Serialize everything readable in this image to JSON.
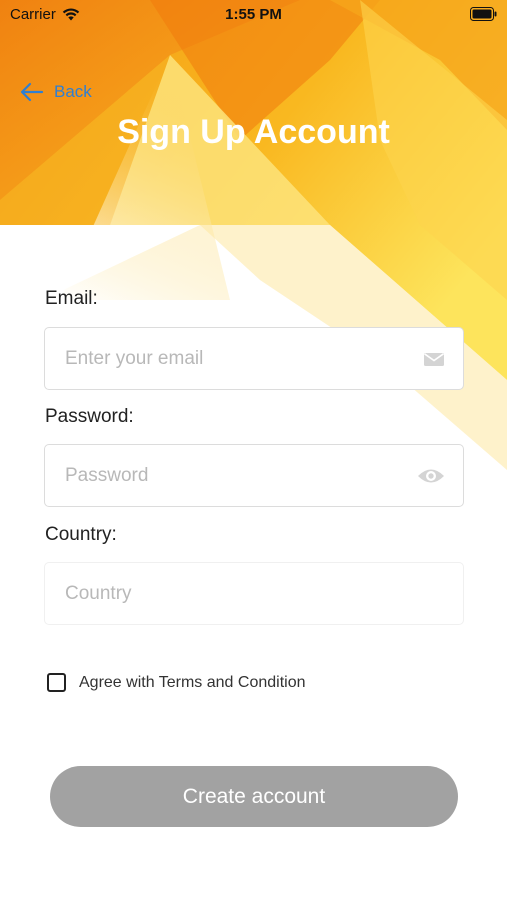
{
  "status_bar": {
    "carrier": "Carrier",
    "time": "1:55 PM"
  },
  "header": {
    "back_label": "Back",
    "title": "Sign Up Account"
  },
  "form": {
    "email": {
      "label": "Email:",
      "placeholder": "Enter your email",
      "value": "",
      "icon": "envelope-icon"
    },
    "password": {
      "label": "Password:",
      "placeholder": "Password",
      "value": "",
      "icon": "eye-icon"
    },
    "country": {
      "label": "Country:",
      "placeholder": "Country",
      "value": ""
    }
  },
  "terms": {
    "label": "Agree with Terms and Condition",
    "checked": false
  },
  "create_button": {
    "label": "Create account"
  },
  "colors": {
    "accent": "#2f7fd1",
    "header_orange": "#f39c12",
    "button_disabled": "#a2a2a2"
  }
}
